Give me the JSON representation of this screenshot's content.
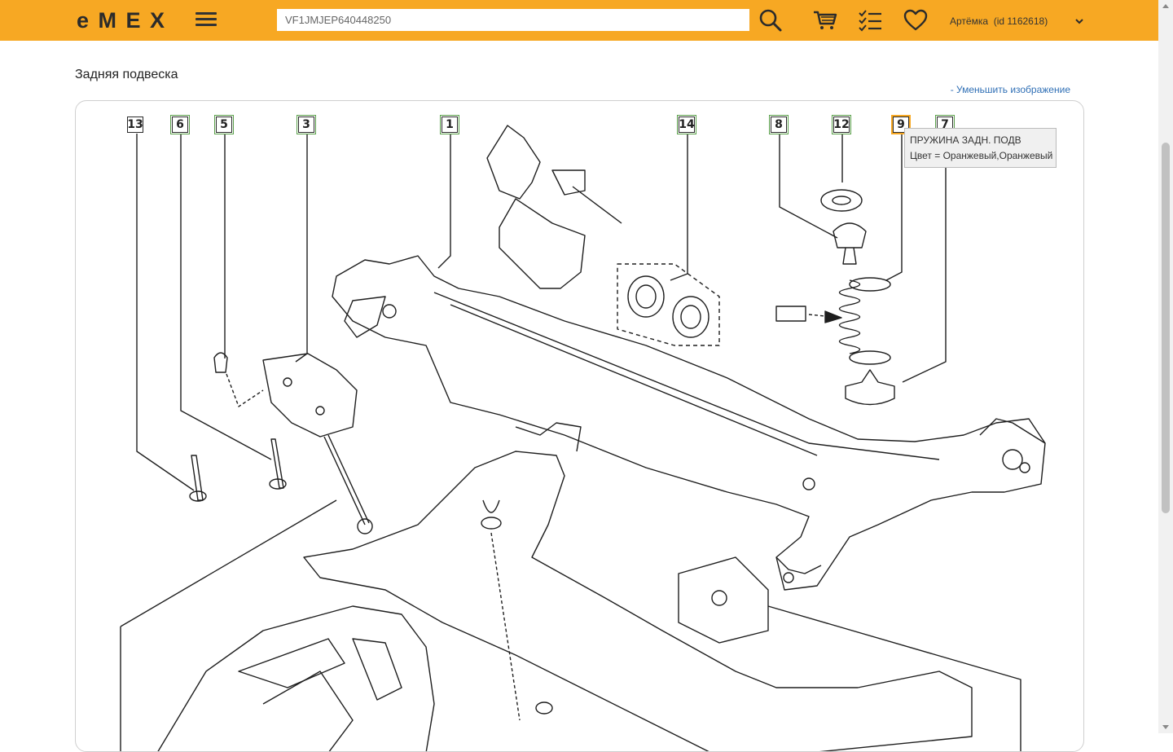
{
  "header": {
    "logo": "e M E X",
    "search": {
      "value": "VF1JMJEP640448250",
      "placeholder": ""
    },
    "account": {
      "name": "Артёмка",
      "id_label": "(id 1162618)"
    }
  },
  "page": {
    "title": "Задняя подвеска",
    "shrink_link": "- Уменьшить изображение"
  },
  "diagram": {
    "callouts": [
      {
        "label": "13"
      },
      {
        "label": "6"
      },
      {
        "label": "5"
      },
      {
        "label": "3"
      },
      {
        "label": "1"
      },
      {
        "label": "14"
      },
      {
        "label": "8"
      },
      {
        "label": "12"
      },
      {
        "label": "9"
      },
      {
        "label": "7"
      }
    ],
    "tooltip": {
      "line1": "ПРУЖИНА ЗАДН. ПОДВ",
      "line2": "Цвет = Оранжевый,Оранжевый"
    }
  },
  "colors": {
    "accent": "#f7a823",
    "link": "#2f6fb5",
    "callout_highlight": "#5aa04a"
  },
  "icons": [
    "menu-icon",
    "search-icon",
    "cart-icon",
    "checklist-icon",
    "heart-icon",
    "chevron-down-icon"
  ]
}
